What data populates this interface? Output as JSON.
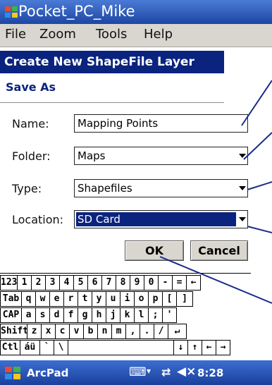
{
  "window": {
    "title": "Pocket_PC_Mike"
  },
  "menu": [
    "File",
    "Zoom",
    "Tools",
    "Help"
  ],
  "dialog": {
    "title": "Create New ShapeFile Layer",
    "section": "Save As",
    "name_label": "Name:",
    "name_value": "Mapping Points",
    "folder_label": "Folder:",
    "folder_value": "Maps",
    "type_label": "Type:",
    "type_value": "Shapefiles",
    "location_label": "Location:",
    "location_value": "SD Card",
    "ok": "OK",
    "cancel": "Cancel"
  },
  "keyboard": {
    "rows": [
      [
        "123",
        "1",
        "2",
        "3",
        "4",
        "5",
        "6",
        "7",
        "8",
        "9",
        "0",
        "-",
        "=",
        "←"
      ],
      [
        "Tab",
        "q",
        "w",
        "e",
        "r",
        "t",
        "y",
        "u",
        "i",
        "o",
        "p",
        "[",
        "]"
      ],
      [
        "CAP",
        "a",
        "s",
        "d",
        "f",
        "g",
        "h",
        "j",
        "k",
        "l",
        ";",
        "'"
      ],
      [
        "Shift",
        "z",
        "x",
        "c",
        "v",
        "b",
        "n",
        "m",
        ",",
        ".",
        "/",
        "↵"
      ],
      [
        "Ctl",
        "áü",
        "`",
        "\\",
        "",
        "↓",
        "↑",
        "←",
        "→"
      ]
    ]
  },
  "taskbar": {
    "app": "ArcPad",
    "time": "8:28"
  }
}
